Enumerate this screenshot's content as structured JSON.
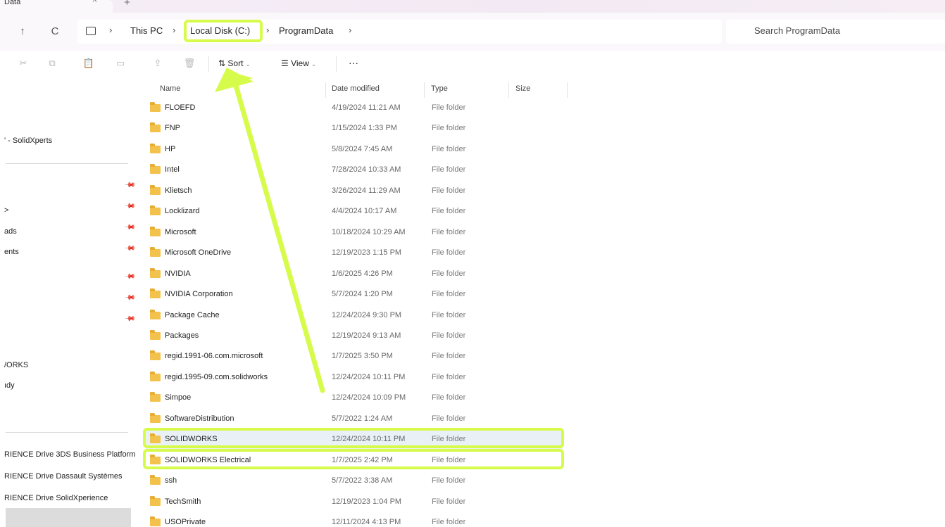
{
  "tab": {
    "title": "Data",
    "close": "^",
    "new": "+"
  },
  "addressbar": {
    "back": "↑",
    "refresh": "C",
    "breadcrumbs": [
      "This PC",
      "Local Disk (C:)",
      "ProgramData"
    ],
    "separator": "›",
    "search_placeholder": "Search ProgramData"
  },
  "commandbar": {
    "cut": "cut-icon",
    "copy": "copy-icon",
    "paste": "paste-icon",
    "rename": "rename-icon",
    "share": "share-icon",
    "delete": "delete-icon",
    "sort_label": "Sort",
    "view_label": "View",
    "more": "···",
    "dropdown": "⌄"
  },
  "navpane": {
    "items": [
      {
        "label": "' - SolidXperts",
        "pinned": false
      },
      {
        "label": ">",
        "pinned": true
      },
      {
        "label": "ads",
        "pinned": true
      },
      {
        "label": "ents",
        "pinned": true
      },
      {
        "label": "",
        "pinned": true
      },
      {
        "label": "",
        "pinned": true
      },
      {
        "label": "",
        "pinned": true
      },
      {
        "label": "/ORKS",
        "pinned": false
      },
      {
        "label": "ıdy",
        "pinned": false
      },
      {
        "label": "RIENCE Drive 3DS Business Platform",
        "pinned": false
      },
      {
        "label": "RIENCE Drive Dassault Systèmes",
        "pinned": false
      },
      {
        "label": "RIENCE Drive SolidXperience",
        "pinned": false
      }
    ],
    "pin_glyph": "📌"
  },
  "columns": {
    "name": "Name",
    "date": "Date modified",
    "type": "Type",
    "size": "Size"
  },
  "files": [
    {
      "name": "FLOEFD",
      "date": "4/19/2024 11:21 AM",
      "type": "File folder"
    },
    {
      "name": "FNP",
      "date": "1/15/2024 1:33 PM",
      "type": "File folder"
    },
    {
      "name": "HP",
      "date": "5/8/2024 7:45 AM",
      "type": "File folder"
    },
    {
      "name": "Intel",
      "date": "7/28/2024 10:33 AM",
      "type": "File folder"
    },
    {
      "name": "Klietsch",
      "date": "3/26/2024 11:29 AM",
      "type": "File folder"
    },
    {
      "name": "Locklizard",
      "date": "4/4/2024 10:17 AM",
      "type": "File folder"
    },
    {
      "name": "Microsoft",
      "date": "10/18/2024 10:29 AM",
      "type": "File folder"
    },
    {
      "name": "Microsoft OneDrive",
      "date": "12/19/2023 1:15 PM",
      "type": "File folder"
    },
    {
      "name": "NVIDIA",
      "date": "1/6/2025 4:26 PM",
      "type": "File folder"
    },
    {
      "name": "NVIDIA Corporation",
      "date": "5/7/2024 1:20 PM",
      "type": "File folder"
    },
    {
      "name": "Package Cache",
      "date": "12/24/2024 9:30 PM",
      "type": "File folder"
    },
    {
      "name": "Packages",
      "date": "12/19/2024 9:13 AM",
      "type": "File folder"
    },
    {
      "name": "regid.1991-06.com.microsoft",
      "date": "1/7/2025 3:50 PM",
      "type": "File folder"
    },
    {
      "name": "regid.1995-09.com.solidworks",
      "date": "12/24/2024 10:11 PM",
      "type": "File folder"
    },
    {
      "name": "Simpoe",
      "date": "12/24/2024 10:09 PM",
      "type": "File folder"
    },
    {
      "name": "SoftwareDistribution",
      "date": "5/7/2022 1:24 AM",
      "type": "File folder"
    },
    {
      "name": "SOLIDWORKS",
      "date": "12/24/2024 10:11 PM",
      "type": "File folder",
      "selected": true,
      "highlighted": true
    },
    {
      "name": "SOLIDWORKS Electrical",
      "date": "1/7/2025 2:42 PM",
      "type": "File folder",
      "highlighted": true
    },
    {
      "name": "ssh",
      "date": "5/7/2022 3:38 AM",
      "type": "File folder"
    },
    {
      "name": "TechSmith",
      "date": "12/19/2023 1:04 PM",
      "type": "File folder"
    },
    {
      "name": "USOPrivate",
      "date": "12/11/2024 4:13 PM",
      "type": "File folder"
    }
  ],
  "colors": {
    "annotation": "#d7fb4b",
    "folder": "#f3c24c",
    "selected_row": "#e9f1f6"
  }
}
